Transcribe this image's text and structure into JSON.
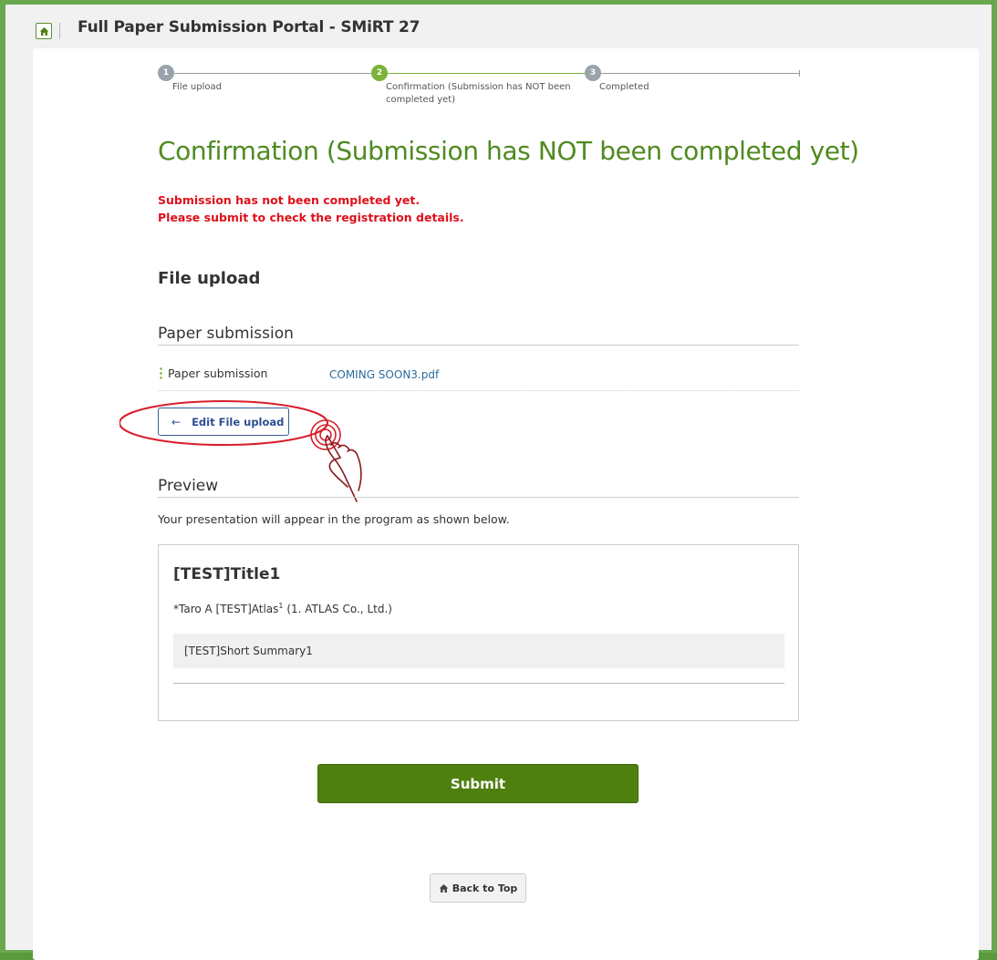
{
  "app": {
    "title": "Full Paper Submission Portal - SMiRT 27",
    "home_icon": "home-icon"
  },
  "stepper": {
    "steps": [
      {
        "number": "1",
        "label": "File upload",
        "state": "done"
      },
      {
        "number": "2",
        "label": "Confirmation (Submission has NOT been completed yet)",
        "state": "current"
      },
      {
        "number": "3",
        "label": "Completed",
        "state": "pending"
      }
    ]
  },
  "page": {
    "heading": "Confirmation (Submission has NOT been completed yet)",
    "warning_line1": "Submission has not been completed yet.",
    "warning_line2": "Please submit to check the registration details.",
    "section_title": "File upload"
  },
  "paper_submission": {
    "subheading": "Paper submission",
    "field_label": "Paper submission",
    "file_name": "COMING SOON3.pdf"
  },
  "edit_button": {
    "label": "Edit File upload",
    "icon": "arrow-left-icon"
  },
  "preview": {
    "subheading": "Preview",
    "description": "Your presentation will appear in the program as shown below.",
    "title": "[TEST]Title1",
    "author_text": "*Taro A [TEST]Atlas",
    "author_sup": "1",
    "affiliation": " (1. ATLAS Co., Ltd.)",
    "summary": "[TEST]Short Summary1"
  },
  "actions": {
    "submit_label": "Submit",
    "back_label": "Back to Top",
    "back_icon": "home-icon"
  },
  "colors": {
    "brand_green": "#4f7f0f",
    "heading_green": "#4f8a1f",
    "warning_red": "#e0101a",
    "link_blue": "#2a6d9c",
    "annotation_red": "#d81e2a"
  }
}
